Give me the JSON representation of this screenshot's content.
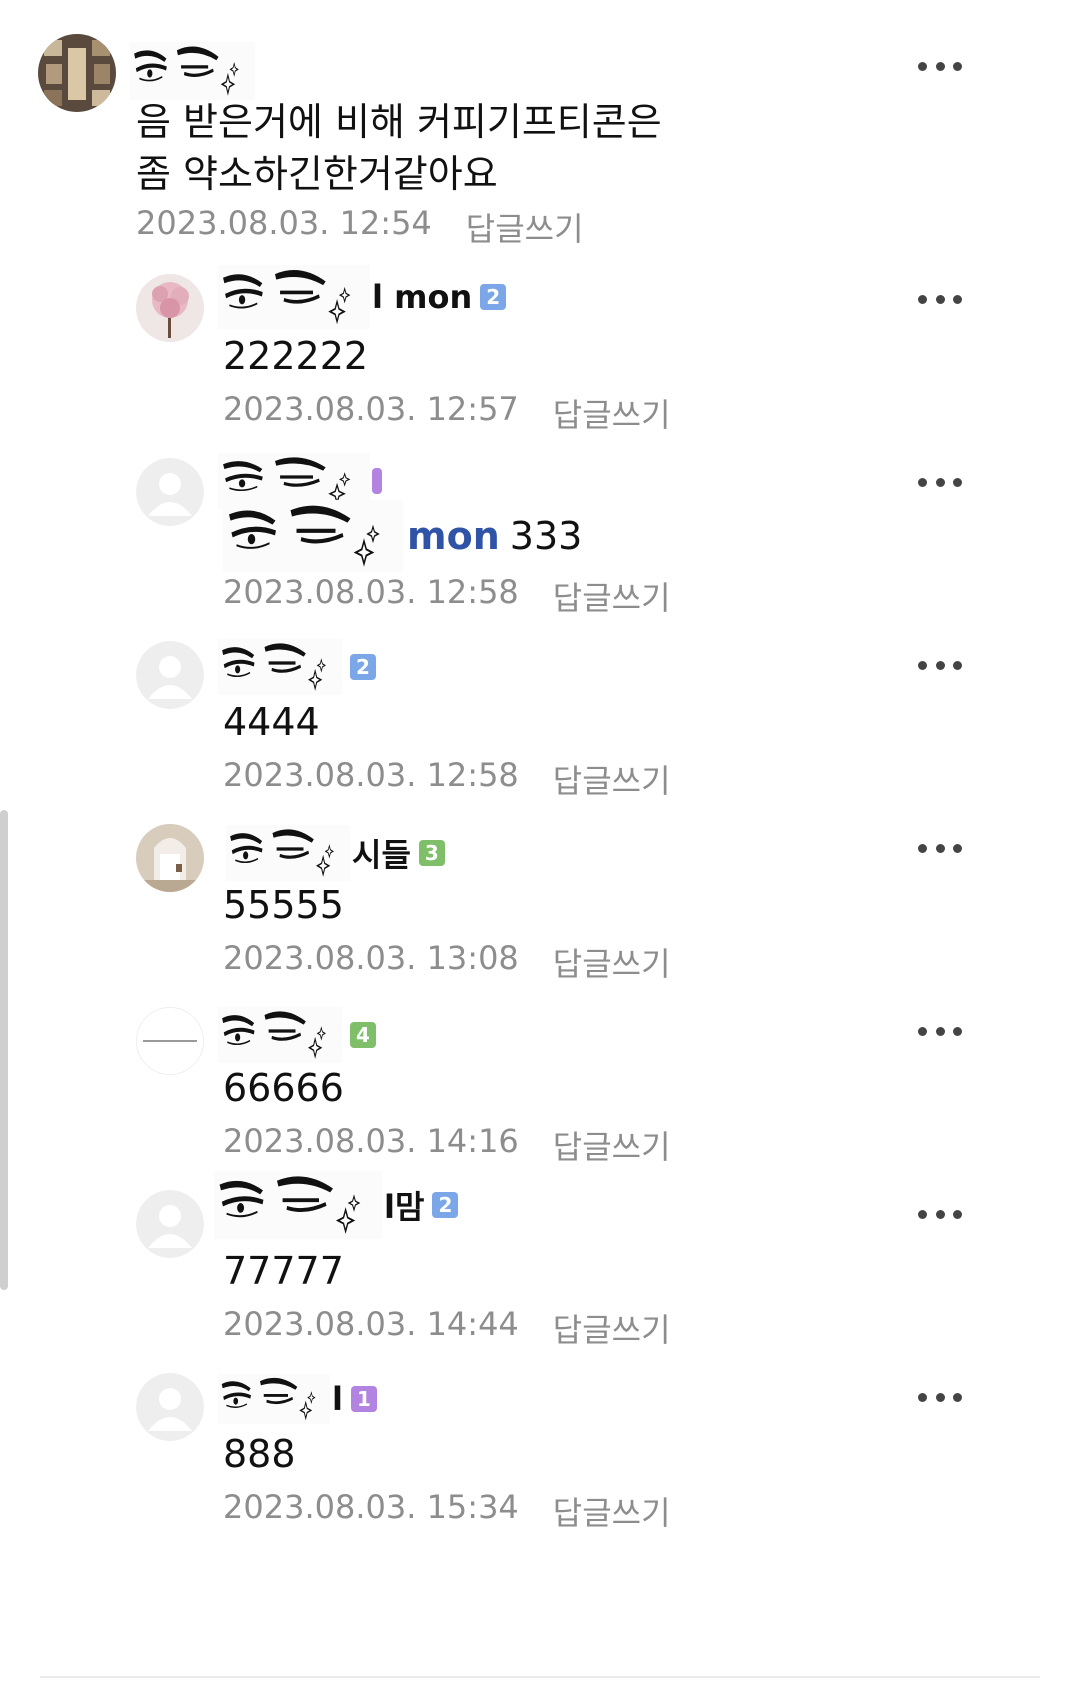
{
  "colors": {
    "badge_1": "#b283e0",
    "badge_2": "#7ba7e8",
    "badge_3": "#7fbf6a",
    "badge_4": "#7fbf6a",
    "mention": "#2f53a6",
    "meta": "#8d8d8d"
  },
  "icons": {
    "more": "more-icon",
    "avatar": "avatar-icon",
    "default_avatar": "default-avatar-icon"
  },
  "comments": [
    {
      "nick_suffix": "",
      "badge": "",
      "text": "음 받은거에 비해 커피기프티콘은\n좀 약소하긴한거같아요",
      "date": "2023.08.03. 12:54",
      "reply": "답글쓰기"
    },
    {
      "nick_suffix": "l mon",
      "badge": "2",
      "text": "222222",
      "date": "2023.08.03. 12:57",
      "reply": "답글쓰기"
    },
    {
      "nick_suffix": "",
      "badge": "",
      "mention": "mon",
      "text": "333",
      "date": "2023.08.03. 12:58",
      "reply": "답글쓰기"
    },
    {
      "nick_suffix": "",
      "badge": "2",
      "text": "4444",
      "date": "2023.08.03. 12:58",
      "reply": "답글쓰기"
    },
    {
      "nick_suffix": "시들",
      "badge": "3",
      "text": "55555",
      "date": "2023.08.03. 13:08",
      "reply": "답글쓰기"
    },
    {
      "nick_suffix": "",
      "badge": "4",
      "text": "66666",
      "date": "2023.08.03. 14:16",
      "reply": "답글쓰기"
    },
    {
      "nick_suffix": "l맘",
      "badge": "2",
      "text": "77777",
      "date": "2023.08.03. 14:44",
      "reply": "답글쓰기"
    },
    {
      "nick_suffix": "l",
      "badge": "1",
      "text": "888",
      "date": "2023.08.03. 15:34",
      "reply": "답글쓰기"
    }
  ]
}
